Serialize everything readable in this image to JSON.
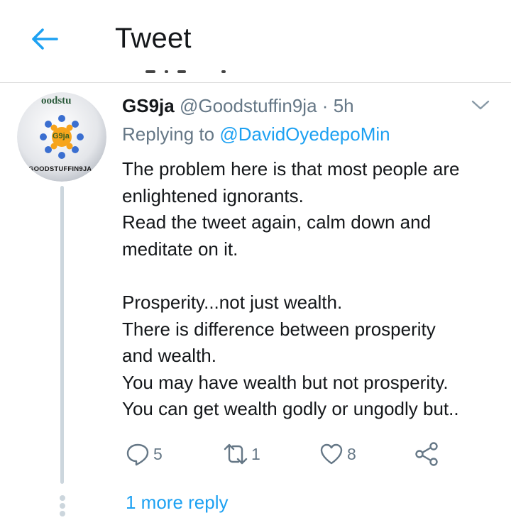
{
  "header": {
    "title": "Tweet",
    "back_icon": "arrow-left-icon",
    "accent_color": "#1da1f2"
  },
  "tweet": {
    "display_name": "GS9ja",
    "handle": "@Goodstuffin9ja",
    "separator": "·",
    "time": "5h",
    "replying_prefix": "Replying to",
    "replying_to": "@DavidOyedepoMin",
    "avatar": {
      "top_text": "oodstu",
      "badge_text": "G9ja",
      "bottom_text": "GOODSTUFFIN9JA"
    },
    "lines": [
      "The problem here is that most people are",
      "enlightened ignorants.",
      "Read the tweet again, calm down and",
      "meditate on it.",
      "",
      "Prosperity...not just wealth.",
      "There is difference between prosperity",
      "and wealth.",
      "You may have wealth but not prosperity.",
      "You can get wealth godly or ungodly but.."
    ],
    "actions": {
      "reply_count": "5",
      "retweet_count": "1",
      "like_count": "8"
    },
    "more_replies": "1 more reply"
  }
}
